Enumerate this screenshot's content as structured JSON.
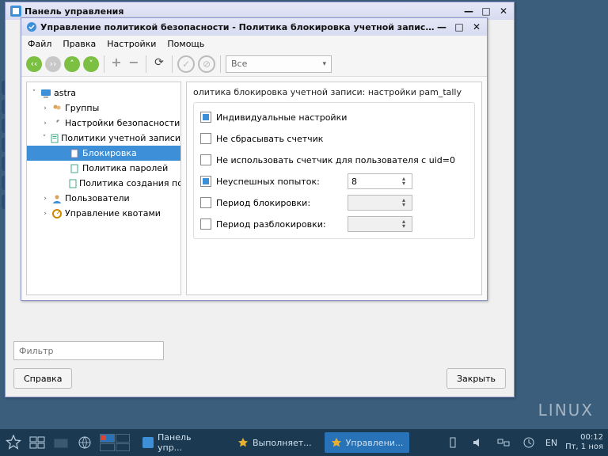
{
  "cp_window": {
    "title": "Панель управления",
    "filter_placeholder": "Фильтр",
    "help_btn": "Справка",
    "close_btn": "Закрыть"
  },
  "sec_window": {
    "title": "Управление политикой безопасности - Политика блокировка учетной записи...",
    "menu": {
      "file": "Файл",
      "edit": "Правка",
      "settings": "Настройки",
      "help": "Помощь"
    },
    "combo": "Все",
    "tree": {
      "root": "astra",
      "groups": "Группы",
      "sec_settings": "Настройки безопасности",
      "policies": "Политики учетной записи",
      "lock": "Блокировка",
      "pw_policy": "Политика паролей",
      "create_policy": "Политика создания пол...",
      "users": "Пользователи",
      "quotas": "Управление квотами"
    },
    "form": {
      "title": "олитика блокировка учетной записи: настройки pam_tally",
      "individual": "Индивидуальные настройки",
      "no_reset": "Не сбрасывать счетчик",
      "no_counter_uid0": "Не использовать счетчик для пользователя с uid=0",
      "fail_attempts": "Неуспешных попыток:",
      "fail_attempts_val": "8",
      "lock_period": "Период блокировки:",
      "unlock_period": "Период разблокировки:"
    }
  },
  "taskbar": {
    "task1": "Панель упр...",
    "task2": "Выполняет...",
    "task3": "Управлени...",
    "lang": "EN",
    "time": "00:12",
    "date": "Пт, 1 ноя"
  },
  "watermark": "LINUX"
}
